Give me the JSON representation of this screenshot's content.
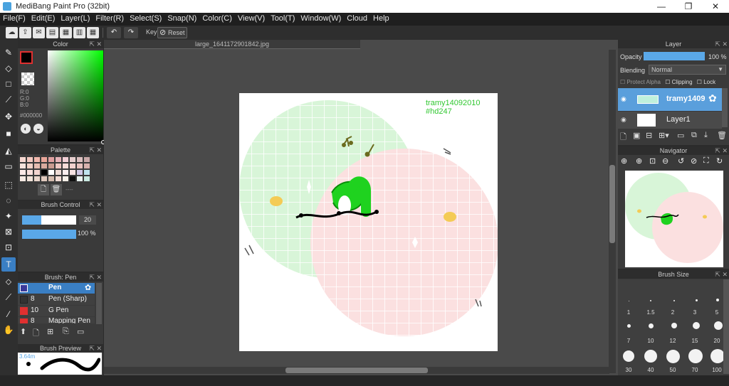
{
  "window": {
    "title": "MediBang Paint Pro (32bit)",
    "min": "—",
    "max": "❐",
    "close": "✕"
  },
  "menu": [
    "File(F)",
    "Edit(E)",
    "Layer(L)",
    "Filter(R)",
    "Select(S)",
    "Snap(N)",
    "Color(C)",
    "View(V)",
    "Tool(T)",
    "Window(W)",
    "Cloud",
    "Help"
  ],
  "toolbar": {
    "key_label": "Key",
    "reset_label": "Reset"
  },
  "document": {
    "tab_name": "large_1641172901842.jpg"
  },
  "color_panel": {
    "title": "Color",
    "r": "R:0",
    "g": "G:0",
    "b": "B:0",
    "hex": "#000000"
  },
  "palette_panel": {
    "title": "Palette",
    "footer": "----",
    "swatches": [
      "#f6d7d0",
      "#f3c9c0",
      "#f1b8ad",
      "#e8a598",
      "#dfa0a0",
      "#e6b3b8",
      "#f2d0d6",
      "#e7cfcf",
      "#dcc0c0",
      "#c9a9a9",
      "#f7e3dc",
      "#f2d1c6",
      "#e6bcb0",
      "#d9aa9e",
      "#c99b90",
      "#eec7c2",
      "#f8dcd8",
      "#f3d3cf",
      "#e8c2be",
      "#d7b1ad",
      "#fbe9e6",
      "#f9e0dc",
      "#f2d4cf",
      "#000000",
      "#ffffff",
      "#eedcd6",
      "#fbeeee",
      "#f6e2e2",
      "#cfc7e5",
      "#bfe3ee",
      "#f6eae3",
      "#f1e3d9",
      "#ead6cc",
      "#e0c9bd",
      "#d4bcae",
      "#f2dcd5",
      "#f7f0e8",
      "#111111",
      "#e9f2ef",
      "#c9e9e1"
    ]
  },
  "brush_control": {
    "title": "Brush Control",
    "size": "20",
    "opacity": "100 %",
    "size_fill": 0.35,
    "opacity_fill": 1.0
  },
  "brush_panel": {
    "title": "Brush: Pen",
    "items": [
      {
        "size": "",
        "name": "Pen",
        "color": "#3a3a9a"
      },
      {
        "size": "8",
        "name": "Pen (Sharp)",
        "color": "#333"
      },
      {
        "size": "10",
        "name": "G Pen",
        "color": "#e03030"
      },
      {
        "size": "8",
        "name": "Mapping Pen",
        "color": "#e03030"
      }
    ]
  },
  "brush_preview": {
    "title": "Brush Preview",
    "value": "3.64m"
  },
  "layer_panel": {
    "title": "Layer",
    "opacity_label": "Opacity",
    "opacity_value": "100 %",
    "opacity_fill": 1.0,
    "blending_label": "Blending",
    "blending_value": "Normal",
    "protect_alpha": "Protect Alpha",
    "clipping": "Clipping",
    "lock": "Lock",
    "layers": [
      {
        "name": "tramy1409",
        "selected": true
      },
      {
        "name": "Layer1",
        "selected": false
      }
    ]
  },
  "navigator": {
    "title": "Navigator"
  },
  "brush_size": {
    "title": "Brush Size",
    "labels_row1": [
      "1",
      "1.5",
      "2",
      "3",
      "5"
    ],
    "labels_row2": [
      "7",
      "10",
      "12",
      "15",
      "20"
    ],
    "labels_row3": [
      "30",
      "40",
      "50",
      "70",
      "100"
    ]
  },
  "artwork": {
    "text_line1": "tramy14092010",
    "text_line2": "#hd247",
    "text_color": "#32c832",
    "left_circle_color": "#d8f5d8",
    "right_circle_color": "#fbe0e0",
    "letter": "a"
  }
}
